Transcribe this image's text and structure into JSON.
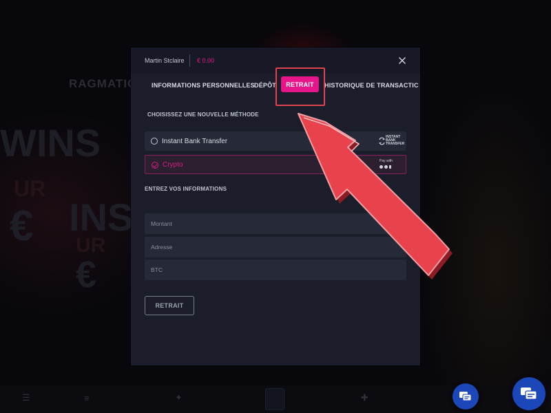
{
  "header": {
    "user_name": "Martin Stclaire",
    "balance": "€ 0.00"
  },
  "tabs": [
    {
      "label": "INFORMATIONS PERSONNELLES",
      "active": false
    },
    {
      "label": "DÉPÔT",
      "active": false
    },
    {
      "label": "RETRAIT",
      "active": true
    },
    {
      "label": "HISTORIQUE DE TRANSACTIC",
      "active": false
    }
  ],
  "methods_section": {
    "title": "CHOISISSEZ UNE NOUVELLE MÉTHODE",
    "methods": [
      {
        "label": "Instant Bank Transfer",
        "selected": false,
        "logo_text": "INSTANT BANK TRANSFER",
        "logo_icon": "bank-transfer-icon"
      },
      {
        "label": "Crypto",
        "selected": true,
        "logo_text": "Pay with",
        "logo_icon": "crypto-coins-icon"
      }
    ]
  },
  "info_section": {
    "title": "ENTREZ VOS INFORMATIONS",
    "fields": [
      {
        "placeholder": "Montant",
        "value": ""
      },
      {
        "placeholder": "Adresse",
        "value": ""
      },
      {
        "placeholder": "BTC",
        "value": ""
      }
    ]
  },
  "submit_label": "RETRAIT",
  "background": {
    "brand": "RAGMATIC",
    "big_text": [
      "WINS",
      "UR",
      "€",
      "INS",
      "UR",
      "€"
    ]
  },
  "colors": {
    "accent": "#e6158a",
    "balance": "#e0188c",
    "arrow": "#e8424c",
    "highlight_box": "#e0444e",
    "chat_button": "#1c47b8",
    "modal_bg": "#1b1d2b",
    "field_bg": "#262938"
  }
}
